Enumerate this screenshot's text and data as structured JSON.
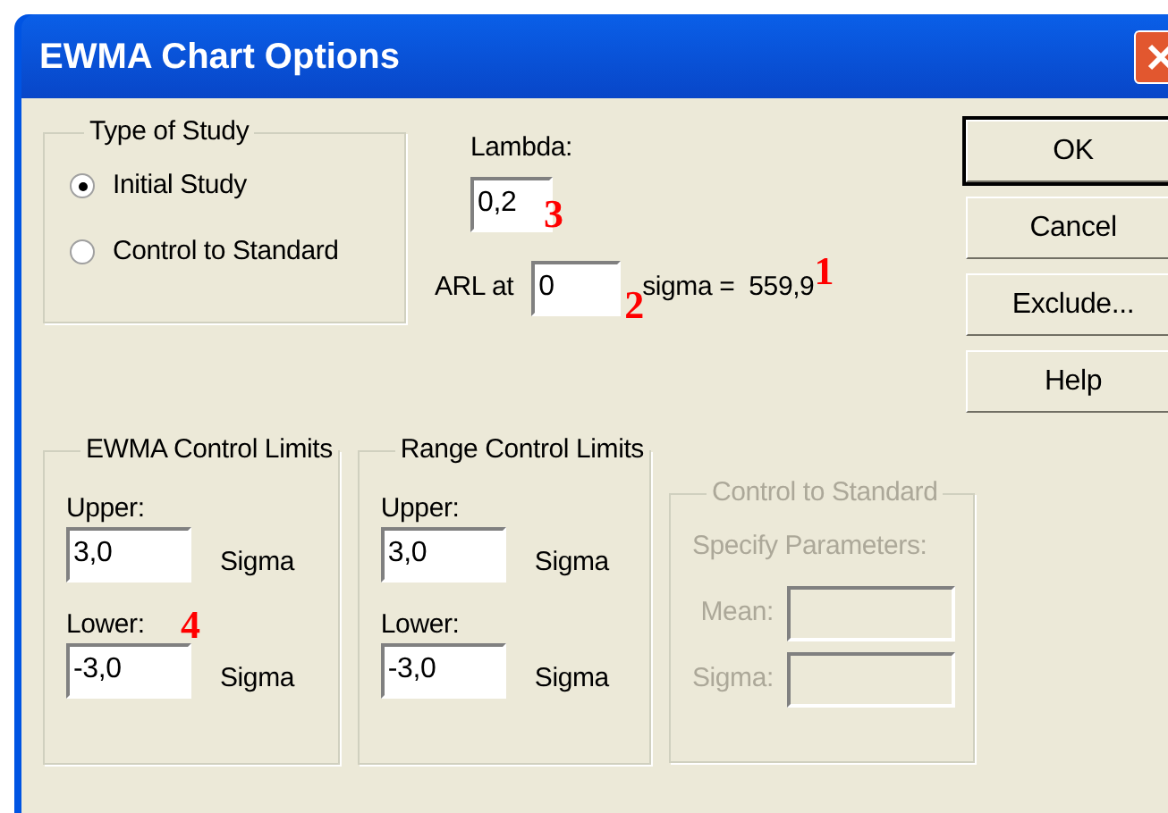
{
  "window": {
    "title": "EWMA Chart Options"
  },
  "type_of_study": {
    "title": "Type of Study",
    "options": [
      {
        "label": "Initial Study",
        "selected": true
      },
      {
        "label": "Control to Standard",
        "selected": false
      }
    ]
  },
  "lambda": {
    "label": "Lambda:",
    "value": "0,2",
    "annotation": "3"
  },
  "arl": {
    "label": "ARL at",
    "value": "0",
    "annotation": "2",
    "suffix": "sigma =",
    "reading": "559,9",
    "reading_annotation": "1"
  },
  "buttons": [
    {
      "label": "OK",
      "default": true
    },
    {
      "label": "Cancel",
      "default": false
    },
    {
      "label": "Exclude...",
      "default": false
    },
    {
      "label": "Help",
      "default": false
    }
  ],
  "limit_groups": [
    {
      "title": "EWMA Control Limits",
      "upper_label": "Upper:",
      "upper": "3,0",
      "upper_unit": "Sigma",
      "lower_label": "Lower:",
      "lower": "-3,0",
      "lower_unit": "Sigma",
      "annotation": "4"
    },
    {
      "title": "Range Control Limits",
      "upper_label": "Upper:",
      "upper": "3,0",
      "upper_unit": "Sigma",
      "lower_label": "Lower:",
      "lower": "-3,0",
      "lower_unit": "Sigma"
    }
  ],
  "control_to_standard": {
    "title": "Control to Standard",
    "disabled": true,
    "subtitle": "Specify Parameters:",
    "fields": [
      {
        "label": "Mean:"
      },
      {
        "label": "Sigma:"
      }
    ]
  }
}
